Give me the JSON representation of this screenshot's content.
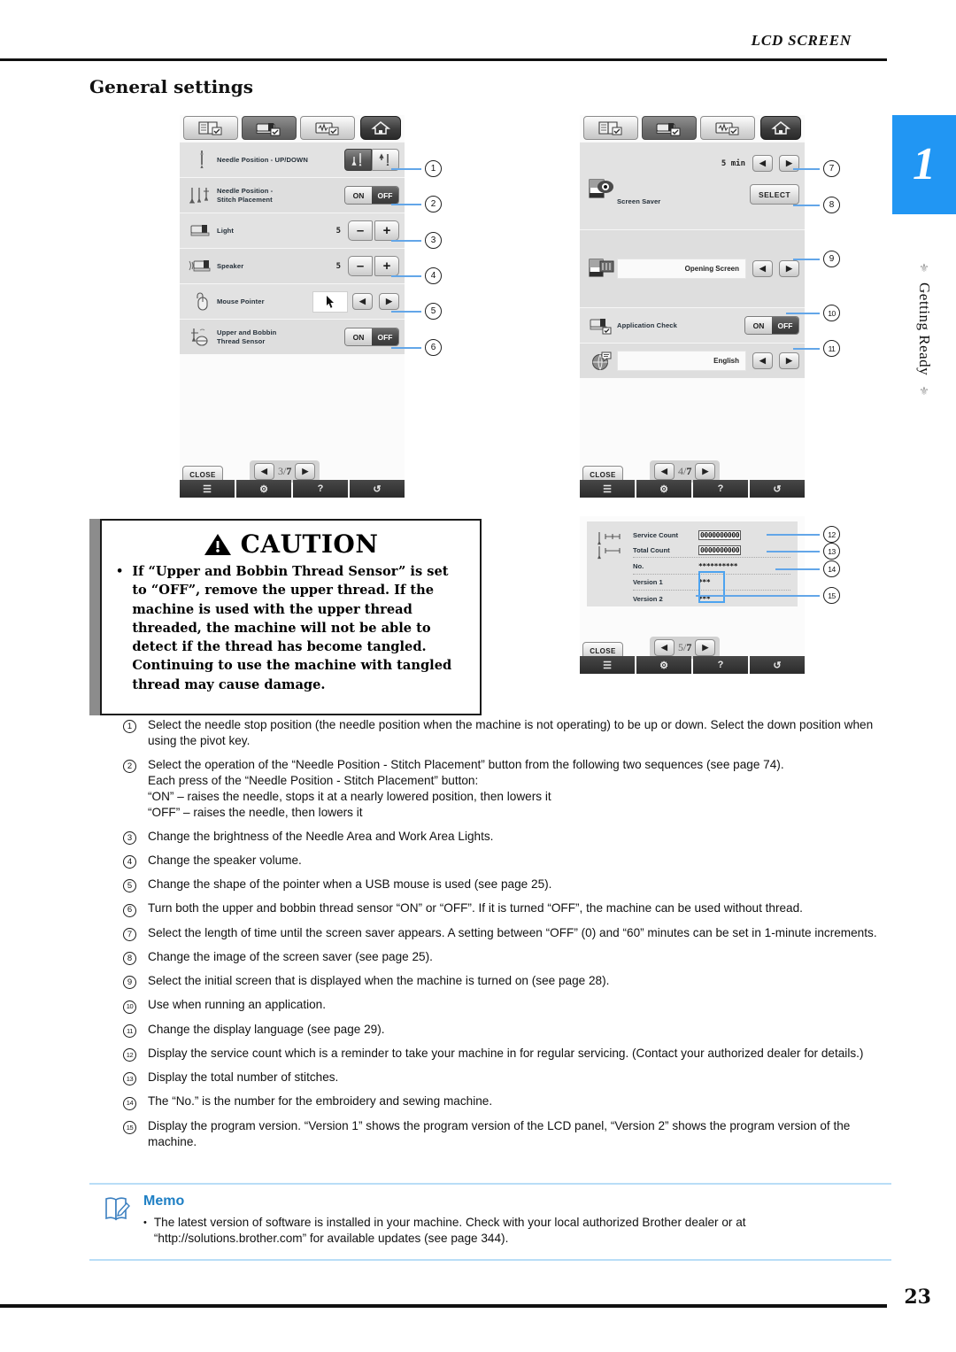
{
  "header": {
    "running_head": "LCD SCREEN",
    "section_title": "General settings"
  },
  "margin_tab": {
    "chapter_number": "1",
    "chapter_name": "Getting Ready",
    "accent_color": "#2196f3"
  },
  "screen1": {
    "tabs": [
      "book-check-icon",
      "machine-check-icon",
      "stitch-check-icon",
      "home-icon"
    ],
    "rows": [
      {
        "icon": "needle-icon",
        "label": "Needle Position - UP/DOWN",
        "control": "up-down-toggle"
      },
      {
        "icon": "needle-triple-icon",
        "label": "Needle Position -\nStitch Placement",
        "control": "on-off",
        "on": "ON",
        "off": "OFF",
        "state": "OFF"
      },
      {
        "icon": "machine-light-icon",
        "label": "Light",
        "value": "5",
        "control": "minus-plus",
        "minus": "–",
        "plus": "+"
      },
      {
        "icon": "machine-speaker-icon",
        "label": "Speaker",
        "value": "5",
        "control": "minus-plus",
        "minus": "–",
        "plus": "+"
      },
      {
        "icon": "mouse-icon",
        "label": "Mouse Pointer",
        "control": "pointer-arrows"
      },
      {
        "icon": "thread-sensor-icon",
        "label": "Upper and Bobbin\nThread Sensor",
        "control": "on-off",
        "on": "ON",
        "off": "OFF",
        "state": "OFF"
      }
    ],
    "footer": {
      "close": "CLOSE",
      "page_current": "3",
      "page_total": "7"
    },
    "taskbar": [
      "document-icon",
      "machine-icon",
      "help-icon",
      "settings-icon"
    ]
  },
  "screen2": {
    "tabs": [
      "book-check-icon",
      "machine-check-icon",
      "stitch-check-icon",
      "home-icon"
    ],
    "rows": [
      {
        "icon": "screen-saver-icon",
        "label": "Screen Saver",
        "value": "5 min",
        "select_label": "SELECT"
      },
      {
        "icon": "opening-screen-icon",
        "field": "Opening Screen"
      },
      {
        "icon": "application-check-icon",
        "label": "Application Check",
        "on": "ON",
        "off": "OFF",
        "state": "OFF"
      },
      {
        "icon": "globe-language-icon",
        "field": "English"
      }
    ],
    "footer": {
      "close": "CLOSE",
      "page_current": "4",
      "page_total": "7"
    },
    "taskbar": [
      "document-icon",
      "machine-icon",
      "help-icon",
      "settings-icon"
    ]
  },
  "screen3": {
    "rows": [
      {
        "icon": "stitch-service-icon",
        "label": "Service Count",
        "value": "0000000000"
      },
      {
        "icon": "stitch-total-icon",
        "label": "Total Count",
        "value": "0000000000"
      },
      {
        "label": "No.",
        "value": "**********"
      },
      {
        "label": "Version 1",
        "value": "***"
      },
      {
        "label": "Version 2",
        "value": "***"
      }
    ],
    "footer": {
      "close": "CLOSE",
      "page_current": "5",
      "page_total": "7"
    },
    "taskbar": [
      "document-icon",
      "machine-icon",
      "help-icon",
      "settings-icon"
    ]
  },
  "callouts": [
    "1",
    "2",
    "3",
    "4",
    "5",
    "6",
    "7",
    "8",
    "9",
    "10",
    "11",
    "12",
    "13",
    "14",
    "15"
  ],
  "caution": {
    "title": "CAUTION",
    "bullet": "•",
    "text": "If “Upper and Bobbin Thread Sensor” is set to “OFF”, remove the upper thread. If the machine is used with the upper thread threaded, the machine will not be able to detect if the thread has become tangled. Continuing to use the machine with tangled thread may cause damage."
  },
  "notes": [
    {
      "num": "1",
      "text": "Select the needle stop position (the needle position when the machine is not operating) to be up or down. Select the down position when using the pivot key."
    },
    {
      "num": "2",
      "text": "Select the operation of the “Needle Position - Stitch Placement” button from the following two sequences (see page 74).\nEach press of the “Needle Position - Stitch Placement” button:\n“ON” – raises the needle, stops it at a nearly lowered position, then lowers it\n“OFF” – raises the needle, then lowers it"
    },
    {
      "num": "3",
      "text": "Change the brightness of the Needle Area and Work Area Lights."
    },
    {
      "num": "4",
      "text": "Change the speaker volume."
    },
    {
      "num": "5",
      "text": "Change the shape of the pointer when a USB mouse is used (see page 25)."
    },
    {
      "num": "6",
      "text": "Turn both the upper and bobbin thread sensor “ON” or “OFF”. If it is turned “OFF”, the machine can be used without thread."
    },
    {
      "num": "7",
      "text": "Select the length of time until the screen saver appears. A setting between “OFF” (0) and “60” minutes can be set in 1-minute increments."
    },
    {
      "num": "8",
      "text": "Change the image of the screen saver (see page 25)."
    },
    {
      "num": "9",
      "text": "Select the initial screen that is displayed when the machine is turned on (see page 28)."
    },
    {
      "num": "10",
      "text": "Use when running an application."
    },
    {
      "num": "11",
      "text": "Change the display language (see page 29)."
    },
    {
      "num": "12",
      "text": "Display the service count which is a reminder to take your machine in for regular servicing. (Contact your authorized dealer for details.)"
    },
    {
      "num": "13",
      "text": "Display the total number of stitches."
    },
    {
      "num": "14",
      "text": "The “No.” is the number for the embroidery and sewing machine."
    },
    {
      "num": "15",
      "text": "Display the program version. “Version 1” shows the program version of the LCD panel, “Version 2” shows the program version of the machine."
    }
  ],
  "memo": {
    "title": "Memo",
    "bullet": "•",
    "text": "The latest version of software is installed in your machine. Check with your local authorized Brother dealer or at “http://solutions.brother.com” for available updates (see page 344)."
  },
  "footer": {
    "page_number": "23"
  }
}
